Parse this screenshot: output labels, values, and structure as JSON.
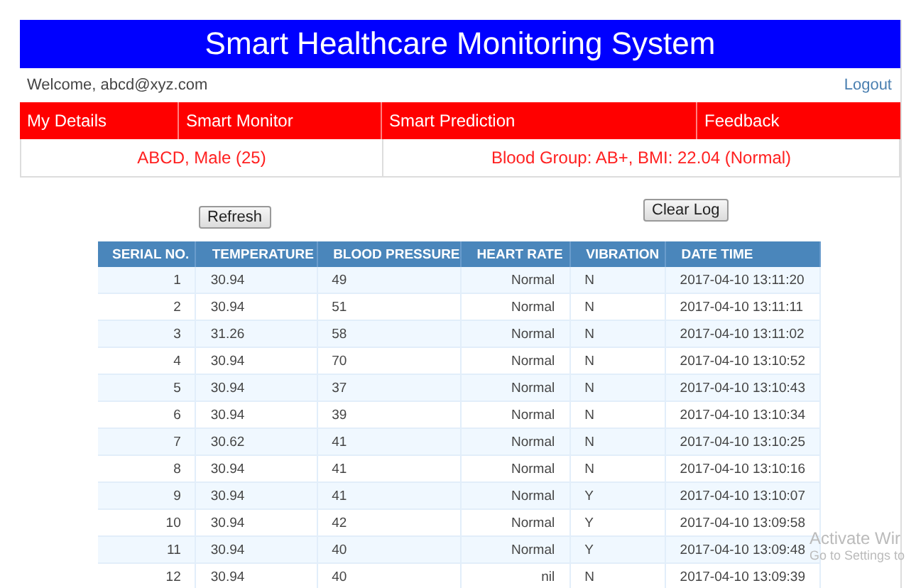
{
  "header": {
    "title": "Smart Healthcare Monitoring System"
  },
  "user_bar": {
    "welcome": "Welcome, abcd@xyz.com",
    "logout": "Logout"
  },
  "nav": [
    {
      "label": "My Details"
    },
    {
      "label": "Smart Monitor"
    },
    {
      "label": "Smart Prediction"
    },
    {
      "label": "Feedback"
    }
  ],
  "info": [
    "ABCD, Male (25)",
    "Blood Group: AB+, BMI: 22.04 (Normal)"
  ],
  "buttons": {
    "refresh": "Refresh",
    "clear_log": "Clear Log"
  },
  "table": {
    "columns": [
      "SERIAL NO.",
      "TEMPERATURE",
      "BLOOD PRESSURE",
      "HEART RATE",
      "VIBRATION",
      "DATE TIME"
    ],
    "rows": [
      [
        "1",
        "30.94",
        "49",
        "Normal",
        "N",
        "2017-04-10 13:11:20"
      ],
      [
        "2",
        "30.94",
        "51",
        "Normal",
        "N",
        "2017-04-10 13:11:11"
      ],
      [
        "3",
        "31.26",
        "58",
        "Normal",
        "N",
        "2017-04-10 13:11:02"
      ],
      [
        "4",
        "30.94",
        "70",
        "Normal",
        "N",
        "2017-04-10 13:10:52"
      ],
      [
        "5",
        "30.94",
        "37",
        "Normal",
        "N",
        "2017-04-10 13:10:43"
      ],
      [
        "6",
        "30.94",
        "39",
        "Normal",
        "N",
        "2017-04-10 13:10:34"
      ],
      [
        "7",
        "30.62",
        "41",
        "Normal",
        "N",
        "2017-04-10 13:10:25"
      ],
      [
        "8",
        "30.94",
        "41",
        "Normal",
        "N",
        "2017-04-10 13:10:16"
      ],
      [
        "9",
        "30.94",
        "41",
        "Normal",
        "Y",
        "2017-04-10 13:10:07"
      ],
      [
        "10",
        "30.94",
        "42",
        "Normal",
        "Y",
        "2017-04-10 13:09:58"
      ],
      [
        "11",
        "30.94",
        "40",
        "Normal",
        "Y",
        "2017-04-10 13:09:48"
      ],
      [
        "12",
        "30.94",
        "40",
        "nil",
        "N",
        "2017-04-10 13:09:39"
      ]
    ]
  },
  "activation_notice": {
    "title": "Activate Wir",
    "subtitle": "Go to Settings to"
  }
}
